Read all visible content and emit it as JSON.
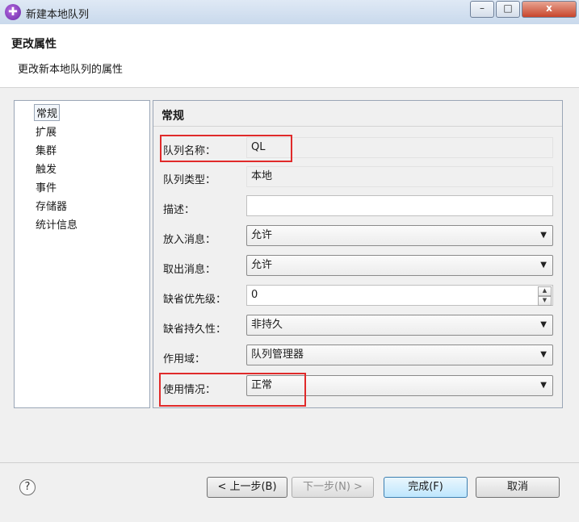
{
  "window": {
    "title": "新建本地队列",
    "controls": {
      "minimize": "–",
      "maximize": "□",
      "close": "x"
    }
  },
  "header": {
    "title": "更改属性",
    "description": "更改新本地队列的属性"
  },
  "nav": {
    "items": [
      {
        "label": "常规",
        "selected": true
      },
      {
        "label": "扩展"
      },
      {
        "label": "集群"
      },
      {
        "label": "触发"
      },
      {
        "label": "事件"
      },
      {
        "label": "存储器"
      },
      {
        "label": "统计信息"
      }
    ]
  },
  "section": {
    "title": "常规",
    "fields": {
      "queue_name": {
        "label": "队列名称：",
        "value": "QL"
      },
      "queue_type": {
        "label": "队列类型：",
        "value": "本地"
      },
      "description": {
        "label": "描述：",
        "value": ""
      },
      "put_messages": {
        "label": "放入消息：",
        "value": "允许"
      },
      "get_messages": {
        "label": "取出消息：",
        "value": "允许"
      },
      "default_priority": {
        "label": "缺省优先级：",
        "value": "0"
      },
      "default_persistence": {
        "label": "缺省持久性：",
        "value": "非持久"
      },
      "scope": {
        "label": "作用域：",
        "value": "队列管理器"
      },
      "usage": {
        "label": "使用情况：",
        "value": "正常"
      }
    }
  },
  "footer": {
    "help": "?",
    "back": "< 上一步(B)",
    "next": "下一步(N) >",
    "finish": "完成(F)",
    "cancel": "取消"
  },
  "icons": {
    "dropdown": "▼",
    "spin_up": "▲",
    "spin_down": "▼"
  },
  "colors": {
    "highlight": "#e02a2a"
  }
}
